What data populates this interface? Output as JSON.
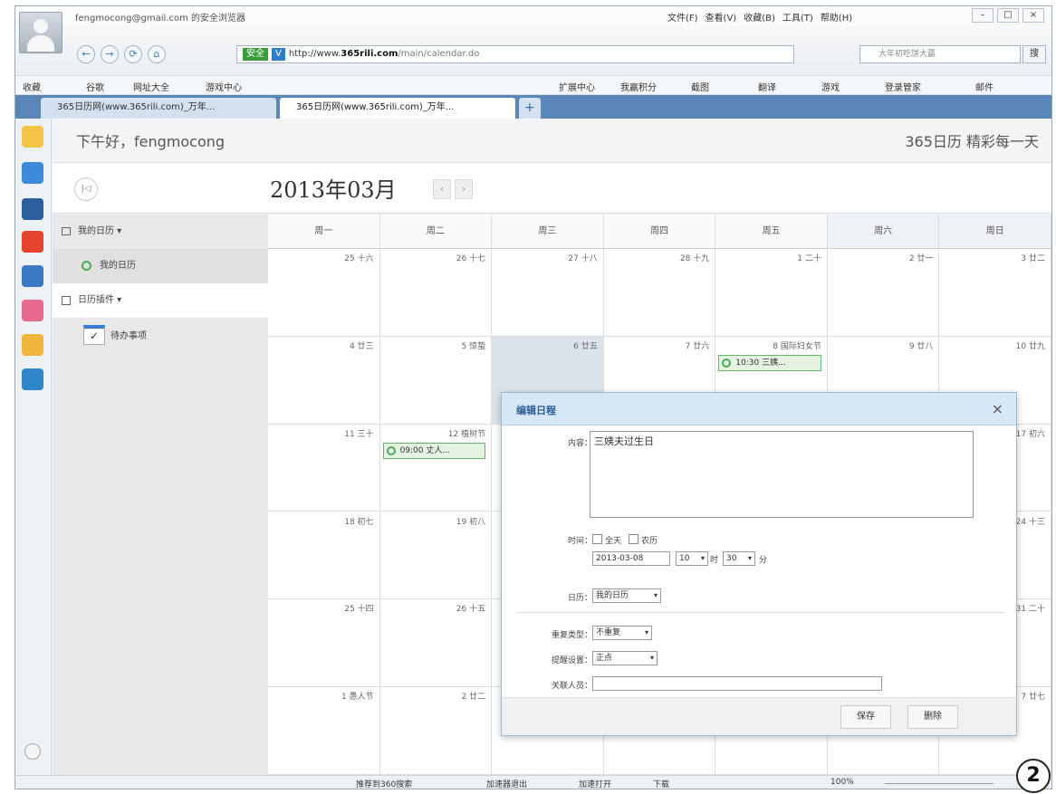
{
  "browser": {
    "account": "fengmocong@gmail.com 的安全浏览器",
    "menus": [
      "文件(F)",
      "查看(V)",
      "收藏(B)",
      "工具(T)",
      "帮助(H)"
    ],
    "window_buttons": [
      "–",
      "□",
      "×"
    ],
    "url": {
      "safe_label": "安全",
      "v_label": "V",
      "prefix": "http://www.",
      "host": "365rili.com",
      "path": "/main/calendar.do"
    },
    "search_placeholder": "大年初吃饼大赢",
    "search_button": "搜",
    "favorites": [
      "收藏",
      "谷歌",
      "网址大全",
      "游戏中心"
    ],
    "toolbar_right": [
      "扩展中心",
      "我赢积分",
      "截图",
      "翻译",
      "游戏",
      "登录管家",
      "邮件"
    ],
    "tabs": [
      "365日历网(www.365rili.com)_万年...",
      "365日历网(www.365rili.com)_万年..."
    ],
    "tab_add": "+",
    "statusbar": [
      "推荐到360搜索",
      "加速器退出",
      "加速打开",
      "下载",
      "100%"
    ]
  },
  "header": {
    "greeting": "下午好，fengmocong",
    "brand": "365日历 精彩每一天"
  },
  "month_bar": {
    "today_label": "|◁",
    "title": "2013年03月",
    "prev": "‹",
    "next": "›"
  },
  "left_panel": {
    "my_calendars_label": "我的日历",
    "my_calendar_item": "我的日历",
    "plugins_label": "日历插件",
    "todo_label": "待办事项"
  },
  "weekdays": [
    "周一",
    "周二",
    "周三",
    "周四",
    "周五",
    "周六",
    "周日"
  ],
  "weeks": [
    [
      {
        "d": "25 十六"
      },
      {
        "d": "26 十七"
      },
      {
        "d": "27 十八"
      },
      {
        "d": "28 十九"
      },
      {
        "d": "1 二十"
      },
      {
        "d": "2 廿一"
      },
      {
        "d": "3 廿二"
      }
    ],
    [
      {
        "d": "4 廿三"
      },
      {
        "d": "5 惊蛰"
      },
      {
        "d": "6 廿五"
      },
      {
        "d": "7 廿六"
      },
      {
        "d": "8 国际妇女节"
      },
      {
        "d": "9 廿八"
      },
      {
        "d": "10 廿九"
      }
    ],
    [
      {
        "d": "11 三十"
      },
      {
        "d": "12 植树节"
      },
      {
        "d": ""
      },
      {
        "d": ""
      },
      {
        "d": ""
      },
      {
        "d": ""
      },
      {
        "d": "17 初六"
      }
    ],
    [
      {
        "d": "18 初七"
      },
      {
        "d": "19 初八"
      },
      {
        "d": ""
      },
      {
        "d": ""
      },
      {
        "d": ""
      },
      {
        "d": ""
      },
      {
        "d": "24 十三"
      }
    ],
    [
      {
        "d": "25 十四"
      },
      {
        "d": "26 十五"
      },
      {
        "d": ""
      },
      {
        "d": ""
      },
      {
        "d": ""
      },
      {
        "d": ""
      },
      {
        "d": "31 二十"
      }
    ],
    [
      {
        "d": "1 愚人节"
      },
      {
        "d": "2 廿二"
      },
      {
        "d": ""
      },
      {
        "d": ""
      },
      {
        "d": ""
      },
      {
        "d": ""
      },
      {
        "d": "7 廿七"
      }
    ]
  ],
  "events": {
    "fri8": "10:30 三姨...",
    "tue12": "09:00 丈人..."
  },
  "dialog": {
    "title": "编辑日程",
    "close": "×",
    "content_label": "内容：",
    "content_value": "三姨夫过生日",
    "time_label": "时间：",
    "allday_label": "全天",
    "lunar_label": "农历",
    "date_value": "2013-03-08",
    "hour_value": "10",
    "hour_unit": "时",
    "minute_value": "30",
    "minute_unit": "分",
    "calendar_label": "日历：",
    "calendar_value": "我的日历",
    "repeat_label": "重复类型：",
    "repeat_value": "不重复",
    "remind_label": "提醒设置：",
    "remind_value": "正点",
    "invite_label": "关联人员：",
    "save_button": "保存",
    "delete_button": "删除"
  },
  "badge": "2"
}
